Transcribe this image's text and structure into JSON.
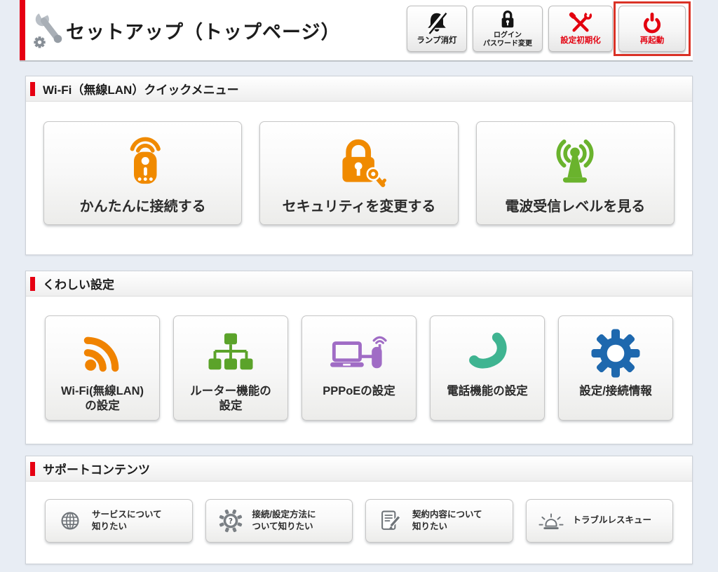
{
  "page": {
    "background_color": "#e8edf4",
    "accent_color": "#e60012"
  },
  "header": {
    "title": "セットアップ（トップページ）",
    "icon": "wrench-gear",
    "actions": {
      "lamp_off": {
        "label": "ランプ消灯",
        "icon": "bell-off",
        "text_color": "#1a1a1a"
      },
      "login_password": {
        "line1": "ログイン",
        "line2": "パスワード変更",
        "icon": "padlock",
        "text_color": "#1a1a1a"
      },
      "factory_reset": {
        "label": "設定初期化",
        "icon": "crossed-tools",
        "text_color": "#e3000f"
      },
      "reboot": {
        "label": "再起動",
        "icon": "power-symbol",
        "text_color": "#e3000f",
        "highlighted": true,
        "highlight_color": "#da3226"
      }
    }
  },
  "quick_menu": {
    "title": "Wi-Fi（無線LAN）クイックメニュー",
    "items": [
      {
        "label": "かんたんに接続する",
        "icon": "wifi-router",
        "icon_color": "#f08a00"
      },
      {
        "label": "セキュリティを変更する",
        "icon": "lock-and-key",
        "icon_color": "#f08a00"
      },
      {
        "label": "電波受信レベルを見る",
        "icon": "antenna-signal",
        "icon_color": "#6ab32d"
      }
    ]
  },
  "detail_settings": {
    "title": "くわしい設定",
    "items": [
      {
        "line1": "Wi-Fi(無線LAN)",
        "line2": "の設定",
        "icon": "wifi-waves",
        "icon_color": "#f08300"
      },
      {
        "line1": "ルーター機能の",
        "line2": "設定",
        "icon": "network-tree",
        "icon_color": "#5ba32a"
      },
      {
        "label": "PPPoEの設定",
        "icon": "pc-and-router",
        "icon_color": "#a06cc5"
      },
      {
        "label": "電話機能の設定",
        "icon": "phone-handset",
        "icon_color": "#3fb491"
      },
      {
        "label": "設定/接続情報",
        "icon": "gear",
        "icon_color": "#1e68ae"
      }
    ]
  },
  "support": {
    "title": "サポートコンテンツ",
    "items": [
      {
        "line1": "サービスについて",
        "line2": "知りたい",
        "icon": "globe"
      },
      {
        "line1": "接続/設定方法に",
        "line2": "ついて知りたい",
        "icon": "gear-question"
      },
      {
        "line1": "契約内容について",
        "line2": "知りたい",
        "icon": "document-pencil"
      },
      {
        "label": "トラブルレスキュー",
        "icon": "siren-lamp"
      }
    ]
  }
}
